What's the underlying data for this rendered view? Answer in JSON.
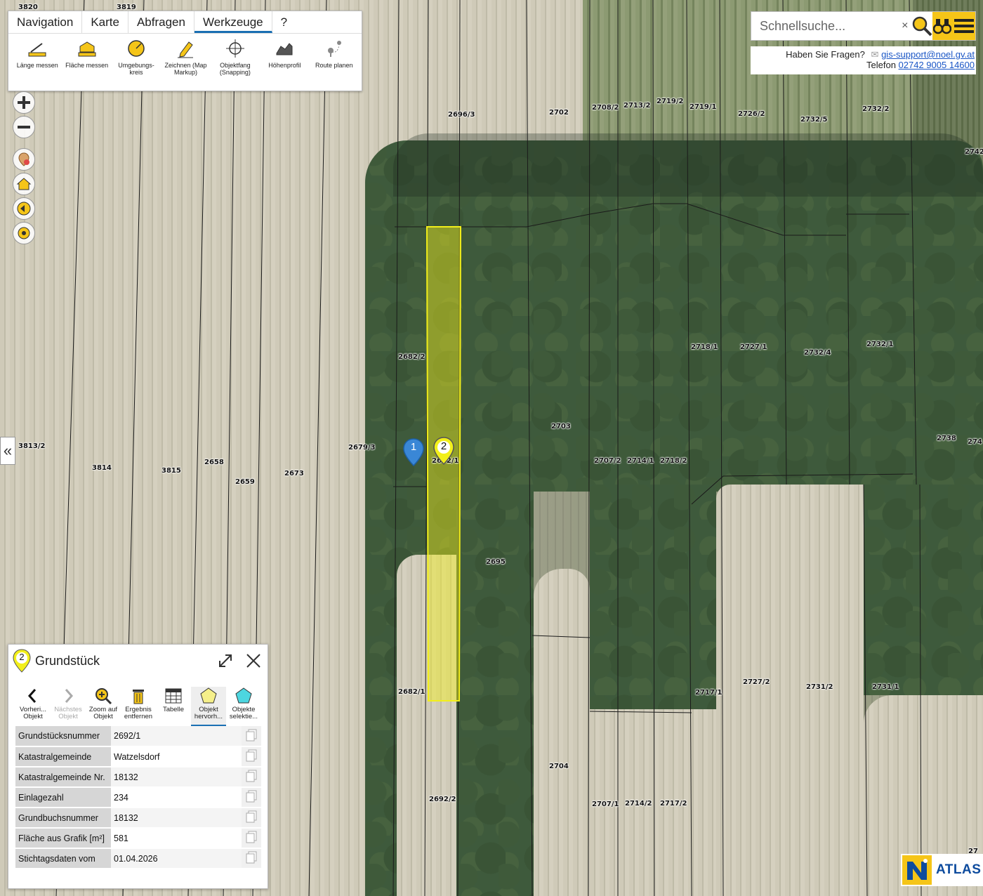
{
  "toolbar": {
    "tabs": [
      {
        "label": "Navigation"
      },
      {
        "label": "Karte"
      },
      {
        "label": "Abfragen"
      },
      {
        "label": "Werkzeuge",
        "active": true
      },
      {
        "label": "?"
      }
    ],
    "tools": [
      {
        "label": "Länge messen"
      },
      {
        "label": "Fläche messen"
      },
      {
        "label": "Umgebungs-kreis"
      },
      {
        "label": "Zeichnen (Map Markup)"
      },
      {
        "label": "Objektfang (Snapping)"
      },
      {
        "label": "Höhenprofil"
      },
      {
        "label": "Route planen"
      }
    ]
  },
  "search": {
    "placeholder": "Schnellsuche...",
    "clear_symbol": "×"
  },
  "help": {
    "question": "Haben Sie Fragen?",
    "email": "gis-support@noel.gv.at",
    "phone_label": "Telefon",
    "phone": "02742 9005 14600"
  },
  "markers": [
    {
      "label": "1",
      "color": "#3a87d6"
    },
    {
      "label": "2",
      "color": "#f2ef1a"
    }
  ],
  "parcel_labels": [
    "3820",
    "3819",
    "2696/3",
    "2702",
    "2708/2",
    "2713/2",
    "2719/2",
    "2719/1",
    "2726/2",
    "2732/5",
    "2732/2",
    "2742",
    "2682/2",
    "2718/1",
    "2727/1",
    "2732/4",
    "2732/1",
    "2703",
    "3813/2",
    "2679/3",
    "2692/1",
    "2738",
    "274",
    "3814",
    "3815",
    "2658",
    "2659",
    "2673",
    "2707/2",
    "2714/1",
    "2718/2",
    "2695",
    "2682/1",
    "2717/1",
    "2727/2",
    "2731/2",
    "2731/1",
    "2704",
    "2692/2",
    "2707/1",
    "2714/2",
    "2717/2",
    "27"
  ],
  "panel": {
    "marker_number": "2",
    "title": "Grundstück",
    "tools": [
      {
        "label": "Vorheri... Objekt",
        "enabled": true
      },
      {
        "label": "Nächstes Objekt",
        "enabled": false
      },
      {
        "label": "Zoom auf Objekt",
        "enabled": true
      },
      {
        "label": "Ergebnis entfernen",
        "enabled": true
      },
      {
        "label": "Tabelle",
        "enabled": true
      },
      {
        "label": "Objekt hervorh...",
        "enabled": true,
        "active": true
      },
      {
        "label": "Objekte selektie...",
        "enabled": true
      }
    ],
    "attributes": [
      {
        "key": "Grundstücksnummer",
        "value": "2692/1"
      },
      {
        "key": "Katastralgemeinde",
        "value": "Watzelsdorf"
      },
      {
        "key": "Katastralgemeinde Nr.",
        "value": "18132"
      },
      {
        "key": "Einlagezahl",
        "value": "234"
      },
      {
        "key": "Grundbuchsnummer",
        "value": "18132"
      },
      {
        "key": "Fläche aus Grafik [m²]",
        "value": "581"
      },
      {
        "key": "Stichtagsdaten vom",
        "value": "01.04.2026"
      }
    ]
  },
  "logo": {
    "text": "ATLAS"
  },
  "colors": {
    "highlight": "#f2ef1a",
    "accent": "#1a6fb3",
    "brand_yellow": "#f5c518",
    "brand_blue": "#0d4b9e"
  }
}
